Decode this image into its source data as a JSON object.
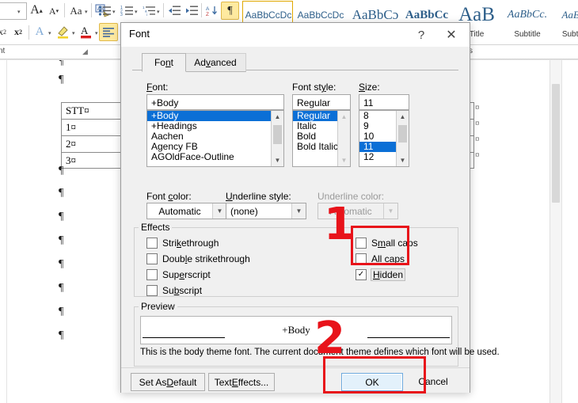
{
  "ribbon": {
    "font_group_label": "nt",
    "styles_group_label": "s",
    "icons_row1": [
      {
        "name": "font-size-box-caret",
        "glyph": "▾"
      },
      {
        "name": "grow-font-icon",
        "glyph": "A"
      },
      {
        "name": "shrink-font-icon",
        "glyph": "A"
      },
      {
        "name": "change-case-icon",
        "glyph": "Aa"
      },
      {
        "name": "change-case-caret",
        "glyph": "▾"
      },
      {
        "name": "clear-formatting-icon",
        "glyph": "✐"
      }
    ],
    "icons_row2": [
      {
        "name": "subscript-icon",
        "glyph": "x₂"
      },
      {
        "name": "superscript-icon",
        "glyph": "x²"
      },
      {
        "name": "text-effects-icon",
        "glyph": "A"
      },
      {
        "name": "text-effects-caret",
        "glyph": "▾"
      },
      {
        "name": "text-highlight-icon",
        "glyph": "✎"
      },
      {
        "name": "text-highlight-caret",
        "glyph": "▾"
      },
      {
        "name": "font-color-icon",
        "glyph": "A"
      },
      {
        "name": "font-color-caret",
        "glyph": "▾"
      }
    ],
    "paragraph_icons": [
      {
        "name": "bullets-icon",
        "glyph": "☰"
      },
      {
        "name": "bullets-caret",
        "glyph": "▾"
      },
      {
        "name": "numbering-icon",
        "glyph": "☰"
      },
      {
        "name": "numbering-caret",
        "glyph": "▾"
      },
      {
        "name": "multilevel-list-icon",
        "glyph": "☰"
      },
      {
        "name": "multilevel-list-caret",
        "glyph": "▾"
      },
      {
        "name": "decrease-indent-icon",
        "glyph": "≡"
      },
      {
        "name": "increase-indent-icon",
        "glyph": "≡"
      },
      {
        "name": "sort-icon",
        "glyph": "A↓"
      },
      {
        "name": "show-formatting-marks-icon",
        "glyph": "¶"
      },
      {
        "name": "align-left-icon",
        "glyph": "≡"
      },
      {
        "name": "align-center-icon",
        "glyph": "≡"
      }
    ],
    "styles": [
      {
        "name": "style-normal",
        "sample": "AaBbCcDc",
        "label": "",
        "size": 12,
        "weight": "normal",
        "style": "normal",
        "selected": true
      },
      {
        "name": "style-no-spacing",
        "sample": "AaBbCcDc",
        "label": "",
        "size": 12,
        "weight": "normal",
        "style": "normal",
        "selected": false
      },
      {
        "name": "style-heading1",
        "sample": "AaBbCɔ",
        "label": "",
        "size": 17,
        "weight": "normal",
        "style": "normal",
        "selected": false
      },
      {
        "name": "style-heading2",
        "sample": "AaBbCc",
        "label": "",
        "size": 15,
        "weight": "bold",
        "style": "normal",
        "selected": false
      },
      {
        "name": "style-title",
        "sample": "AaB",
        "label": "Title",
        "size": 25,
        "weight": "normal",
        "style": "normal",
        "selected": false
      },
      {
        "name": "style-subtitle",
        "sample": "AaBbCc.",
        "label": "Subtitle",
        "size": 14,
        "weight": "normal",
        "style": "italic",
        "selected": false
      },
      {
        "name": "style-subtle-emphasis",
        "sample": "AaBb",
        "label": "Subtle",
        "size": 13,
        "weight": "normal",
        "style": "italic",
        "selected": false
      }
    ]
  },
  "document": {
    "table": {
      "rows": [
        "STT¤",
        "1¤",
        "2¤",
        "3¤"
      ],
      "row_end_mark": "¤"
    },
    "pilcrow": "¶"
  },
  "dialog": {
    "title": "Font",
    "help_icon": "?",
    "close_icon": "✕",
    "tabs": [
      {
        "label": "Font",
        "active": true
      },
      {
        "label": "Advanced",
        "active": false
      }
    ],
    "font_section": {
      "font_label": "Font:",
      "font_value": "+Body",
      "font_list": [
        "+Body",
        "+Headings",
        "Aachen",
        "Agency FB",
        "AGOldFace-Outline"
      ],
      "font_selected": "+Body",
      "style_label": "Font style:",
      "style_value": "Regular",
      "style_list": [
        "Regular",
        "Italic",
        "Bold",
        "Bold Italic"
      ],
      "style_selected": "Regular",
      "size_label": "Size:",
      "size_value": "11",
      "size_list": [
        "8",
        "9",
        "10",
        "11",
        "12"
      ],
      "size_selected": "11"
    },
    "color_section": {
      "font_color_label": "Font color:",
      "font_color_value": "Automatic",
      "underline_style_label": "Underline style:",
      "underline_style_value": "(none)",
      "underline_color_label": "Underline color:",
      "underline_color_value": "Automatic",
      "underline_color_disabled": true
    },
    "effects": {
      "group_label": "Effects",
      "left": [
        {
          "label": "Strikethrough",
          "checked": false
        },
        {
          "label": "Double strikethrough",
          "checked": false
        },
        {
          "label": "Superscript",
          "checked": false
        },
        {
          "label": "Subscript",
          "checked": false
        }
      ],
      "right": [
        {
          "label": "Small caps",
          "checked": false
        },
        {
          "label": "All caps",
          "checked": false
        },
        {
          "label": "Hidden",
          "checked": true
        }
      ],
      "check_glyph": "✓"
    },
    "preview": {
      "group_label": "Preview",
      "sample_text": "+Body",
      "description": "This is the body theme font. The current document theme defines which font will be used."
    },
    "footer": {
      "set_as_default": "Set As Default",
      "text_effects": "Text Effects...",
      "ok": "OK",
      "cancel": "Cancel"
    }
  },
  "annotations": {
    "step_one": "1",
    "step_two": "2",
    "highlight_color": "#e8131a"
  }
}
